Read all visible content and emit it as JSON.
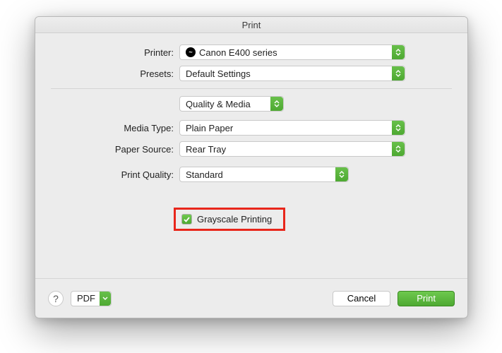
{
  "title": "Print",
  "rows": {
    "printer": {
      "label": "Printer:",
      "value": "Canon E400 series"
    },
    "presets": {
      "label": "Presets:",
      "value": "Default Settings"
    },
    "section": {
      "value": "Quality & Media"
    },
    "media_type": {
      "label": "Media Type:",
      "value": "Plain Paper"
    },
    "paper_source": {
      "label": "Paper Source:",
      "value": "Rear Tray"
    },
    "print_quality": {
      "label": "Print Quality:",
      "value": "Standard"
    }
  },
  "checkbox": {
    "label": "Grayscale Printing",
    "checked": true
  },
  "footer": {
    "help": "?",
    "pdf": "PDF",
    "cancel": "Cancel",
    "print": "Print"
  }
}
